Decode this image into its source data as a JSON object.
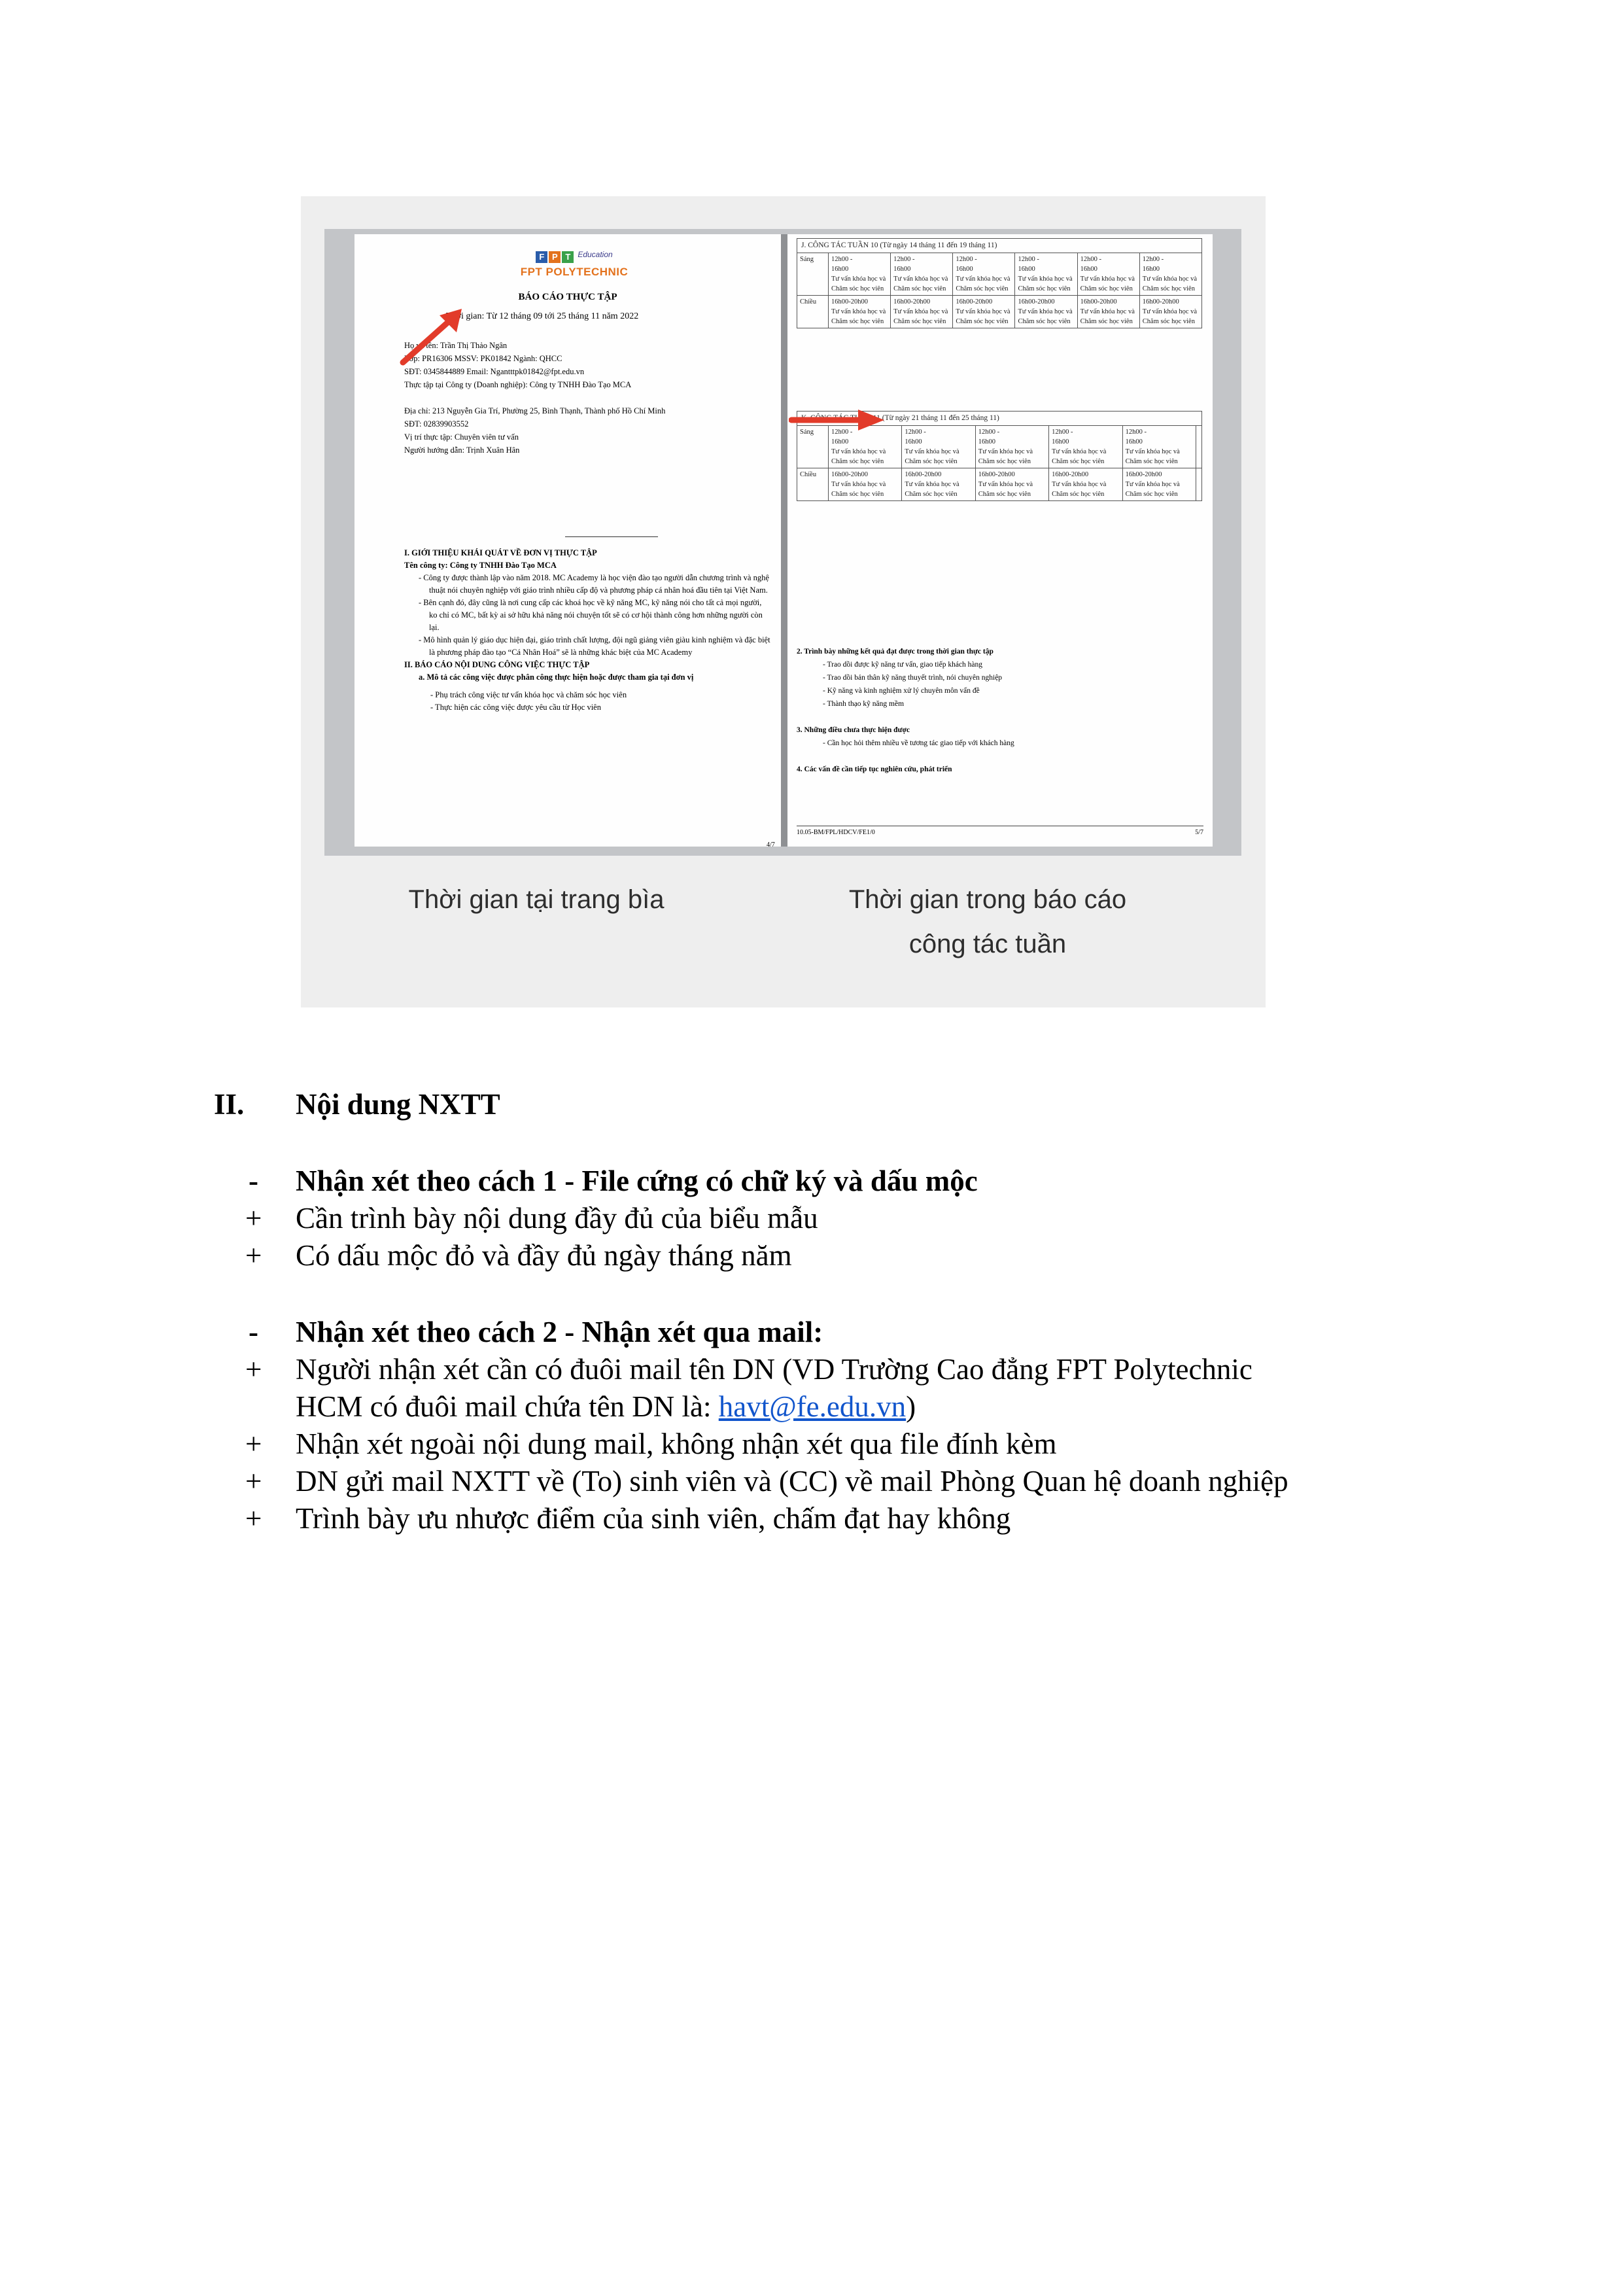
{
  "figure": {
    "left_report": {
      "logo_mark": [
        "F",
        "P",
        "T"
      ],
      "logo_sub": "Education",
      "logo_brand": "FPT POLYTECHNIC",
      "title": "BÁO CÁO THỰC TẬP",
      "time": "Thời gian: Từ 12 tháng 09 tới 25 tháng 11 năm 2022",
      "info": [
        "Họ và tên: Trần Thị Thảo Ngân",
        "Lớp: PR16306        MSSV: PK01842 Ngành: QHCC",
        "SĐT: 0345844889   Email: Ngantttpk01842@fpt.edu.vn",
        "Thực tập tại Công ty (Doanh nghiệp): Công ty TNHH Đào Tạo MCA",
        "",
        "Địa chỉ: 213 Nguyễn Gia Trí, Phường 25, Bình Thạnh, Thành phố Hồ Chí Minh",
        "SĐT: 02839903552",
        "Vị trí thực tập: Chuyên viên tư vấn",
        "Người hướng dẫn: Trịnh Xuân Hân"
      ],
      "sec1_title": "I.        GIỚI THIỆU KHÁI QUÁT VỀ ĐƠN VỊ THỰC TẬP",
      "company": "Tên công ty: Công ty TNHH Đào Tạo MCA",
      "bullets": [
        "-   Công ty được thành lập vào năm 2018. MC Academy là học viện đào tạo người dẫn chương trình và nghệ thuật nói chuyên nghiệp với giáo trình nhiều cấp độ và phương pháp cá nhân hoá đầu tiên tại Việt Nam.",
        "-   Bên cạnh đó, đây cũng là nơi cung cấp các khoá học về kỹ năng MC, kỹ năng nói cho tất cả mọi người, ko chỉ có MC, bất kỳ ai sở hữu khả năng nói chuyện tốt sẽ có cơ hội thành công hơn những người còn lại.",
        "-   Mô hình quản lý giáo dục hiện đại, giáo trình chất lượng, đội ngũ giảng viên giàu kinh nghiệm và đặc biệt là phương pháp đào tạo “Cá Nhân Hoá” sẽ là những khác biệt của MC Academy"
      ],
      "sec2_title": "II.       BÁO CÁO NỘI DUNG CÔNG VIỆC THỰC TẬP",
      "sec2a": "a.        Mô tả các công việc được phân công thực hiện hoặc được tham gia tại đơn vị",
      "tasks": [
        "-      Phụ trách công việc tư vấn khóa học và chăm sóc học viên",
        "-      Thực hiện các công việc được yêu cầu từ Học viên"
      ],
      "page_num": "4/7"
    },
    "right_report": {
      "week10": "J. CÔNG TÁC TUẦN 10 (Từ ngày 14 tháng 11 đến 19 tháng 11)",
      "week11": "K. CÔNG TÁC TUẦN 11 (Từ ngày 21 tháng 11 đến 25 tháng 11)",
      "sang": "Sáng",
      "chieu": "Chiều",
      "am_cell": "12h00  -\n16h00\nTư vấn khóa học và Chăm sóc học viên",
      "pm_cell": "16h00-20h00\nTư vấn khóa học và Chăm sóc học viên",
      "sec2": "2.     Trình bày những kết quả đạt được trong thời gian thực tập",
      "results": [
        "-   Trao dồi được kỹ năng tư vấn, giao tiếp khách hàng",
        "-   Trao dồi bản thân kỹ năng thuyết trình, nói chuyên nghiệp",
        "-   Kỹ năng và kinh nghiệm xử lý chuyên môn vấn đề",
        "-   Thành thạo kỹ năng mềm"
      ],
      "sec3": "3.     Những điều chưa thực hiện được",
      "not_done": "-   Cần học hỏi thêm nhiều về tương tác giao tiếp với khách hàng",
      "sec4": "4.     Các vấn đề cần tiếp tục nghiên cứu, phát triển",
      "footer_code": "10.05-BM/FPL/HDCV/FE1/0",
      "page_num": "5/7"
    },
    "caption_left": "Thời gian tại trang bìa",
    "caption_right_1": "Thời gian trong báo cáo",
    "caption_right_2": "công tác tuần"
  },
  "section": {
    "num": "II.",
    "title": "Nội dung NXTT"
  },
  "method1": {
    "bullet": "-",
    "title": "Nhận xét theo cách 1 - File cứng có chữ ký và dấu mộc",
    "items": [
      "Cần trình bày nội dung đầy đủ của biểu mẫu",
      "Có dấu mộc đỏ và đầy đủ ngày tháng năm"
    ]
  },
  "method2": {
    "bullet": "-",
    "title": "Nhận xét theo cách 2 - Nhận xét qua mail:",
    "item1_line1": "Người nhận xét cần có đuôi mail tên DN (VD Trường Cao đẳng FPT Polytechnic",
    "item1_line2_pre": "HCM có đuôi mail chứa tên DN là: ",
    "item1_email": "havt@fe.edu.vn",
    "item1_line2_post": ")",
    "items": [
      "Nhận xét ngoài nội dung mail, không nhận xét qua file đính kèm",
      "DN gửi mail NXTT về (To) sinh viên và (CC) về mail Phòng Quan hệ doanh nghiệp",
      "Trình bày ưu nhược điểm của sinh viên, chấm đạt hay không"
    ]
  },
  "plus": "+",
  "colors": {
    "fpt_blue": "#2a5caa",
    "fpt_orange": "#e3721d",
    "fpt_green": "#3aa14a",
    "arrow_red": "#e23b2a",
    "link": "#1155cc"
  }
}
